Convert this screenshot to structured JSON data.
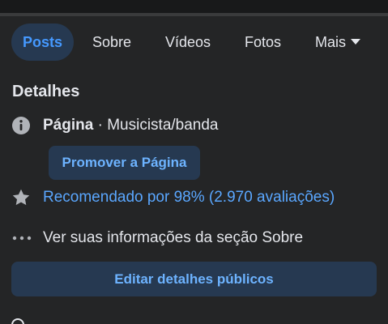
{
  "tabs": [
    {
      "label": "Posts",
      "active": true
    },
    {
      "label": "Sobre"
    },
    {
      "label": "Vídeos"
    },
    {
      "label": "Fotos"
    },
    {
      "label": "Mais"
    }
  ],
  "details": {
    "title": "Detalhes",
    "page_label": "Página",
    "separator": " · ",
    "category": "Musicista/banda",
    "promote_button": "Promover a Página",
    "recommendation": "Recomendado por 98% (2.970 avaliações)",
    "about_link": "Ver suas informações da seção Sobre",
    "edit_button": "Editar detalhes públicos"
  },
  "colors": {
    "background": "#242526",
    "accent": "#4599ff",
    "button_bg": "#263951"
  },
  "icons": [
    "info-icon",
    "star-icon",
    "more-dots-icon",
    "chevron-down-icon"
  ]
}
